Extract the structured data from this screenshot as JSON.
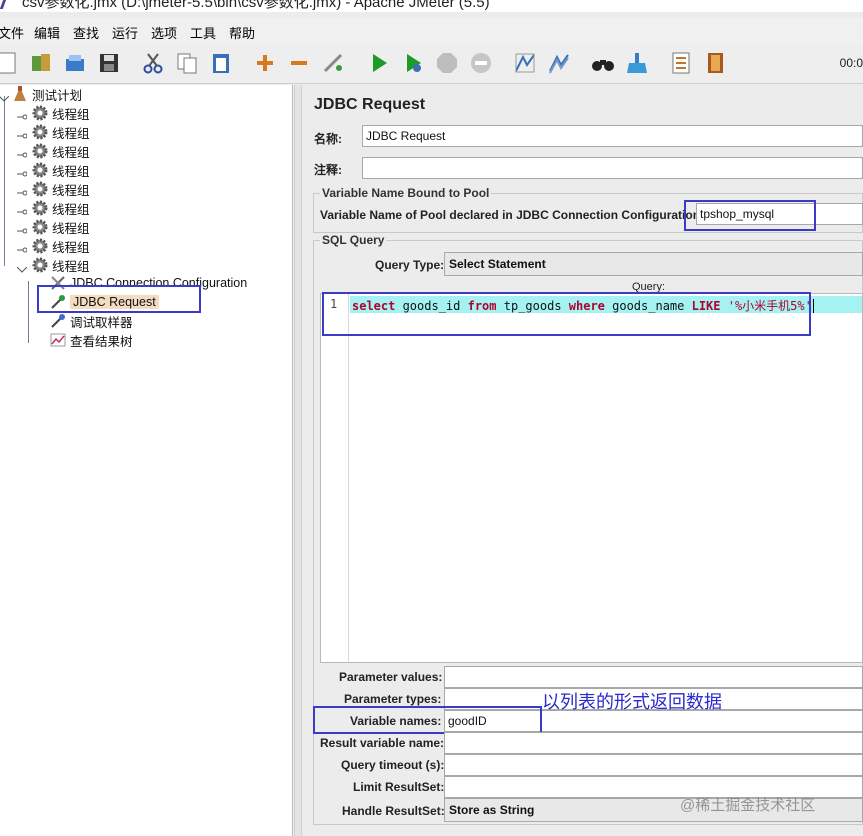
{
  "window": {
    "title": "csv参数化.jmx (D:\\jmeter-5.5\\bin\\csv参数化.jmx) - Apache JMeter (5.5)"
  },
  "menu": [
    "文件",
    "编辑",
    "查找",
    "运行",
    "选项",
    "工具",
    "帮助"
  ],
  "toolbar": {
    "timer": "00:0"
  },
  "tree": {
    "root": "测试计划",
    "thread_groups": [
      "线程组",
      "线程组",
      "线程组",
      "线程组",
      "线程组",
      "线程组",
      "线程组",
      "线程组",
      "线程组"
    ],
    "children": [
      "JDBC Connection Configuration",
      "JDBC Request",
      "调试取样器",
      "查看结果树"
    ]
  },
  "panel": {
    "title": "JDBC Request",
    "name_label": "名称:",
    "name_value": "JDBC Request",
    "comment_label": "注释:",
    "comment_value": "",
    "pool_group_label": "Variable Name Bound to Pool",
    "pool_label": "Variable Name of Pool declared in JDBC Connection Configuration:",
    "pool_value": "tpshop_mysql",
    "sql_group_label": "SQL Query",
    "query_type_label": "Query Type:",
    "query_type_value": "Select Statement",
    "query_label": "Query:",
    "line_number": "1",
    "query_tokens": {
      "t1": "select",
      "t2": " goods_id ",
      "t3": "from",
      "t4": " tp_goods ",
      "t5": "where",
      "t6": " goods_name ",
      "t7": "LIKE",
      "t8": " '%小米手机5%'"
    },
    "param_values_label": "Parameter values:",
    "param_types_label": "Parameter types:",
    "variable_names_label": "Variable names:",
    "variable_names_value": "goodID",
    "annotation": "以列表的形式返回数据",
    "result_var_label": "Result variable name:",
    "query_timeout_label": "Query timeout (s):",
    "limit_label": "Limit ResultSet:",
    "handle_label": "Handle ResultSet:",
    "handle_value": "Store as String"
  },
  "watermark": "@稀土掘金技术社区",
  "colors": {
    "highlight_box": "#3b3bc9",
    "line_highlight": "#a5f2f2",
    "keyword": "#b5002b",
    "selected_node": "#f4dcc0"
  }
}
